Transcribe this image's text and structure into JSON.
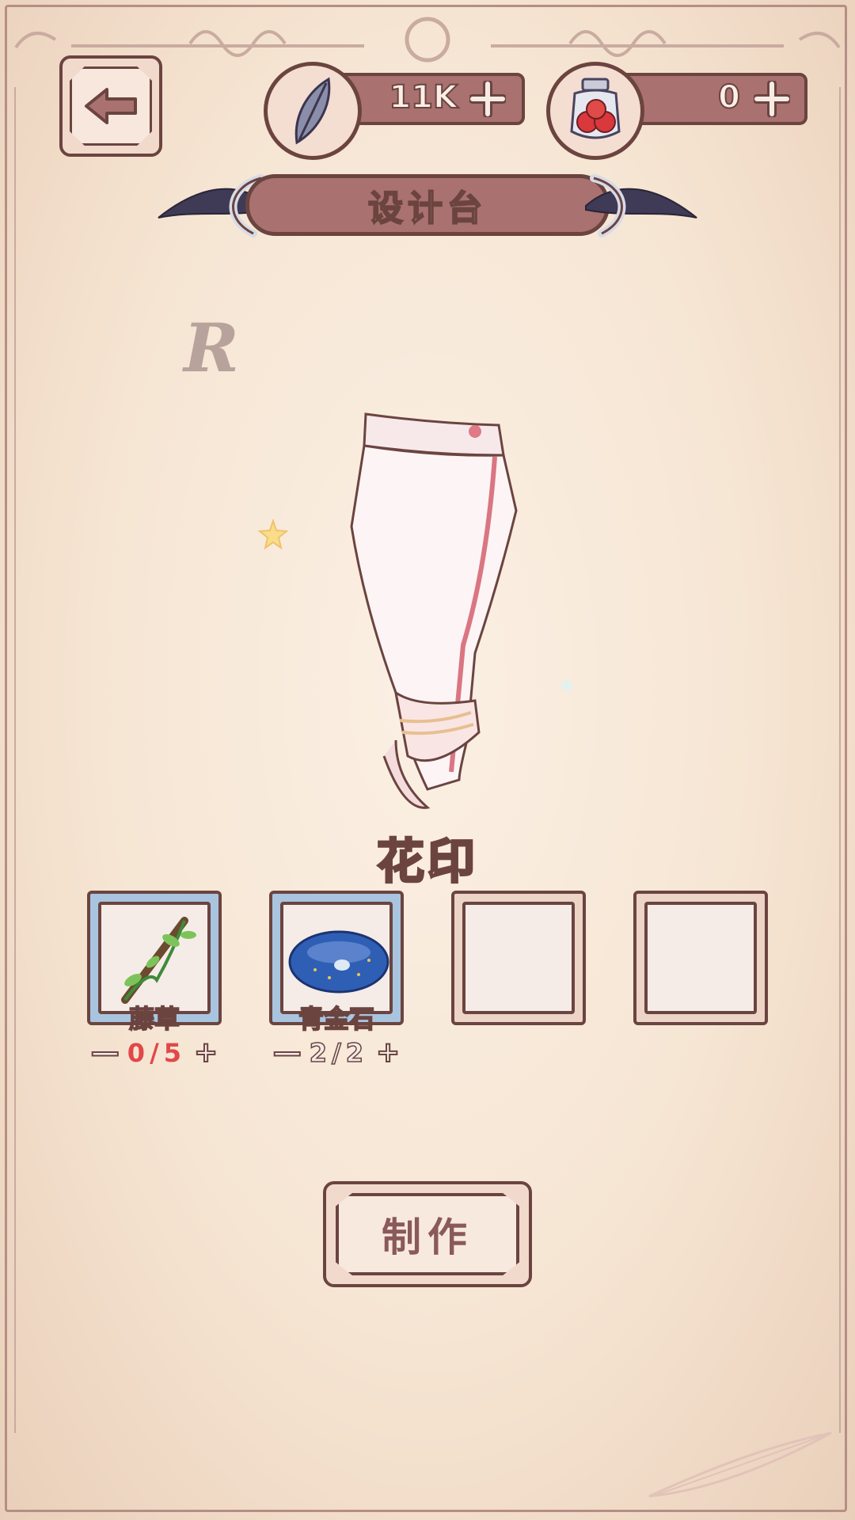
{
  "header": {
    "back_label": "",
    "currencies": [
      {
        "name": "feather",
        "icon": "feather-icon",
        "value": "11K"
      },
      {
        "name": "jar",
        "icon": "berry-jar-icon",
        "value": "0"
      }
    ],
    "title": "设计台"
  },
  "item": {
    "rarity": "R",
    "name": "花印",
    "preview_icon": "pants-icon"
  },
  "materials": [
    {
      "label": "藤草",
      "icon": "vine-icon",
      "owned": "0",
      "required": "5",
      "status": "short"
    },
    {
      "label": "青金石",
      "icon": "lapis-stone-icon",
      "owned": "2",
      "required": "2",
      "status": "ok"
    },
    {
      "label": "",
      "icon": "",
      "owned": "",
      "required": "",
      "status": "empty"
    },
    {
      "label": "",
      "icon": "",
      "owned": "",
      "required": "",
      "status": "empty"
    }
  ],
  "actions": {
    "make_label": "制作"
  },
  "colors": {
    "panel": "#a97170",
    "outline": "#6b4440",
    "short": "#e14848",
    "slot_filled": "#a9c4df"
  }
}
